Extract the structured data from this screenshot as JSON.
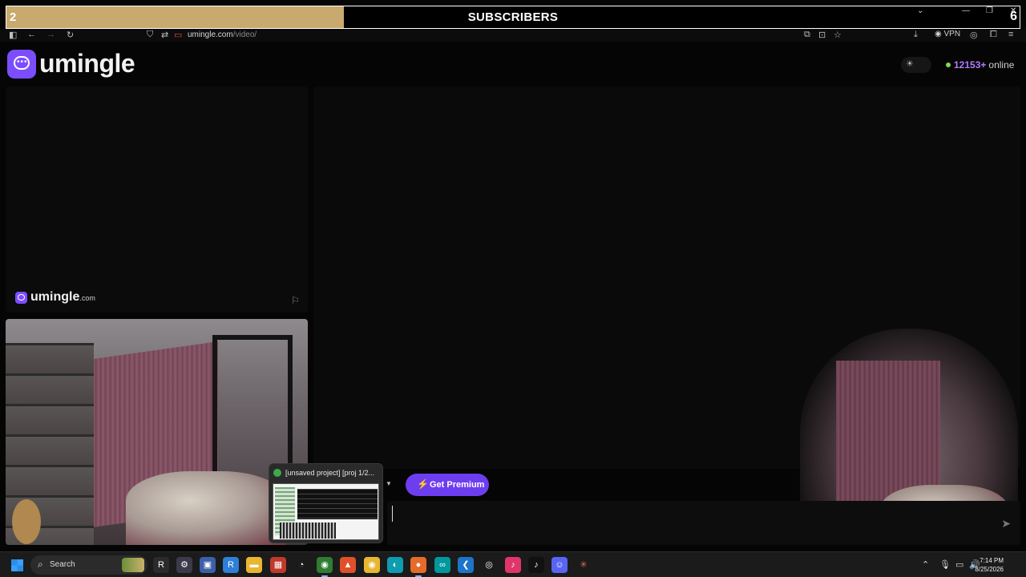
{
  "subscribers": {
    "left": "2",
    "title": "SUBSCRIBERS",
    "right": "6",
    "progress": 0.333
  },
  "browser": {
    "url_domain": "umingle.com",
    "url_path": "/video/",
    "vpn_label": "VPN"
  },
  "site": {
    "logo_text": "umingle",
    "online_count": "12153+",
    "online_label": "online",
    "accent": "#7c4dff"
  },
  "stranger_panel": {
    "watermark": "umingle",
    "watermark_suffix": ".com"
  },
  "controls": {
    "premium_label": "Get Premium"
  },
  "chat": {
    "input_value": "",
    "input_placeholder": ""
  },
  "taskbar_popup": {
    "title": "[unsaved project] [proj 1/2..."
  },
  "taskbar": {
    "search_label": "Search",
    "time": "7:14 PM",
    "date": "8/25/2026",
    "apps": [
      "file-explorer",
      "R",
      "network",
      "remote",
      "folder",
      "calendar",
      "clock",
      "chrome-canary",
      "brave",
      "chrome",
      "edge",
      "firefox",
      "arduino",
      "vscode",
      "obs",
      "tiktok-1",
      "tiktok-2",
      "discord",
      "claude"
    ]
  }
}
